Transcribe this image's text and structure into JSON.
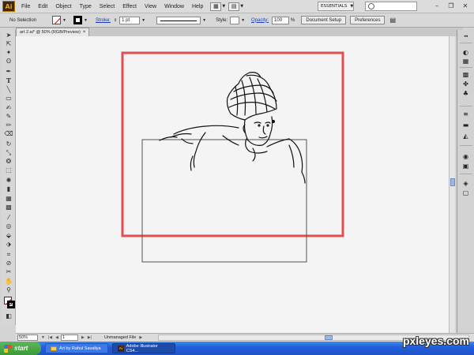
{
  "app": {
    "logo": "Ai",
    "workspace": "ESSENTIALS"
  },
  "menu": [
    "File",
    "Edit",
    "Object",
    "Type",
    "Select",
    "Effect",
    "View",
    "Window",
    "Help"
  ],
  "control_bar": {
    "selection_label": "No Selection",
    "stroke_label": "Stroke:",
    "stroke_weight": "1 pt",
    "style_label": "Style:",
    "opacity_label": "Opacity:",
    "opacity_value": "100",
    "opacity_unit": "%",
    "document_setup": "Document Setup",
    "preferences": "Preferences"
  },
  "document_tab": {
    "title": "art 2.ai* @ 50% (RGB/Preview)",
    "close": "×"
  },
  "status_bar": {
    "zoom": "50%",
    "page": "1",
    "status": "Unmanaged File"
  },
  "taskbar": {
    "start": "start",
    "items": [
      "Art by Rahul Savaliya",
      "Adobe Illustrator CS4..."
    ]
  },
  "watermark": "pxleyes.com",
  "colors": {
    "selection_rect": "#e05050",
    "taskbar": "#245edb",
    "start": "#3a9a38"
  },
  "icons": {
    "tools": [
      "selection-tool-icon",
      "direct-selection-tool-icon",
      "magic-wand-icon",
      "lasso-icon",
      "pen-icon",
      "type-icon",
      "line-icon",
      "rectangle-icon",
      "paintbrush-icon",
      "pencil-icon",
      "blob-brush-icon",
      "eraser-icon",
      "rotate-icon",
      "scale-icon",
      "warp-icon",
      "free-transform-icon",
      "symbol-sprayer-icon",
      "column-graph-icon",
      "mesh-icon",
      "gradient-icon",
      "eyedropper-icon",
      "blend-icon",
      "live-paint-icon",
      "live-paint-select-icon",
      "crop-icon",
      "slice-icon",
      "scissors-icon",
      "hand-icon",
      "zoom-icon"
    ],
    "dock": [
      "color-icon",
      "color-guide-icon",
      "swatches-icon",
      "brushes-icon",
      "symbols-icon",
      "stroke-icon",
      "gradient-panel-icon",
      "transparency-icon",
      "appearance-icon",
      "graphic-styles-icon",
      "layers-icon",
      "artboards-icon"
    ]
  }
}
